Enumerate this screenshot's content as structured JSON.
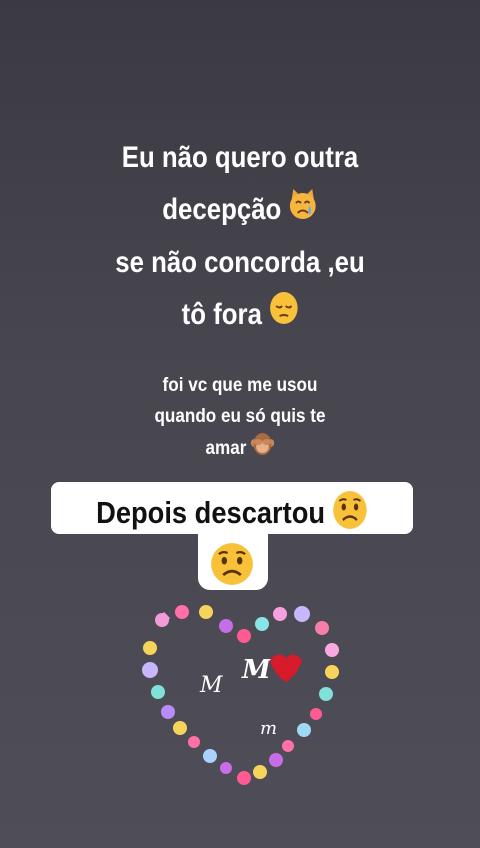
{
  "story": {
    "main_lines": [
      "Eu não quero outra",
      "decepção",
      "se não concorda ,eu",
      "tô fora"
    ],
    "secondary_lines": [
      "foi vc que me usou",
      "quando eu só quis te",
      "amar"
    ],
    "highlight_text": "Depois descartou",
    "sticker_letters": {
      "big_m": "M",
      "m_left": "M",
      "m_small": "m"
    }
  },
  "icons": {
    "crying_cat": "crying-cat-emoji",
    "pensive": "pensive-face-emoji",
    "see_no_evil": "see-no-evil-monkey-emoji",
    "worried": "worried-face-emoji",
    "heart_frame": "heart-emoji-frame-sticker"
  },
  "colors": {
    "background_top": "#3b3a42",
    "background_bottom": "#4f4d57",
    "text": "#ffffff",
    "highlight_bg": "#ffffff",
    "emoji_yellow": "#f7c13a"
  }
}
